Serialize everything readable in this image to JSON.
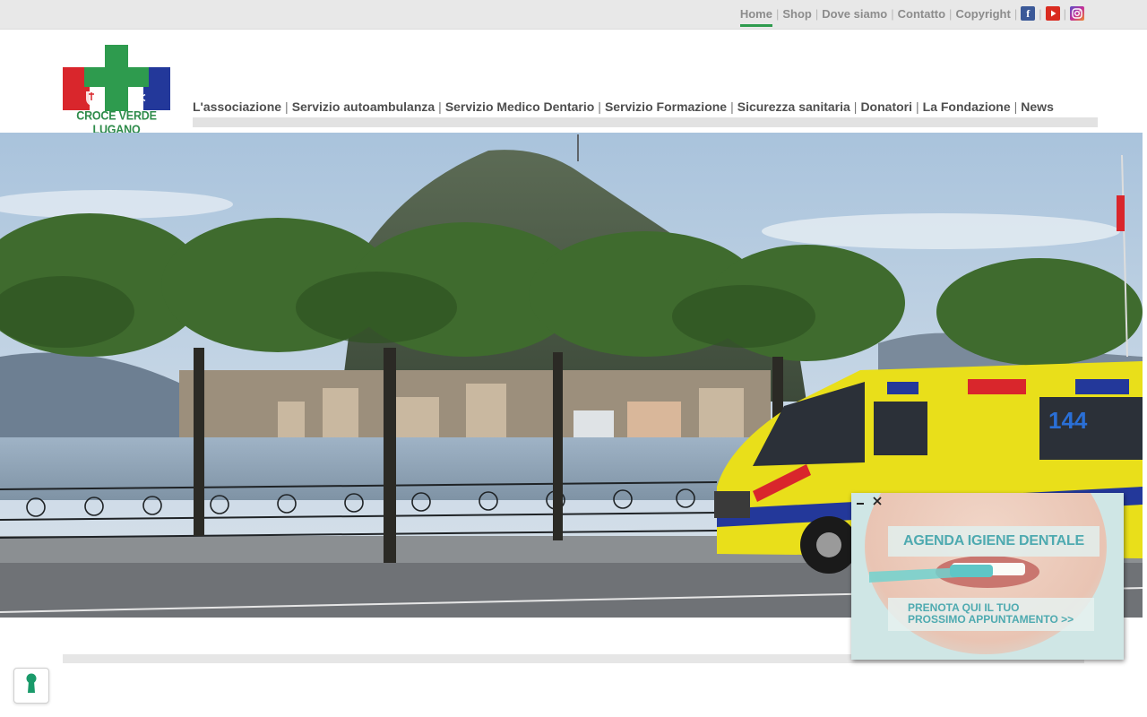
{
  "top_nav": {
    "items": [
      {
        "label": "Home",
        "active": true
      },
      {
        "label": "Shop",
        "active": false
      },
      {
        "label": "Dove siamo",
        "active": false
      },
      {
        "label": "Contatto",
        "active": false
      },
      {
        "label": "Copyright",
        "active": false
      }
    ],
    "separator": "|",
    "social": [
      {
        "name": "facebook-icon",
        "glyph": "f",
        "color": "#3b5998"
      },
      {
        "name": "youtube-icon",
        "color": "#d92b20"
      },
      {
        "name": "instagram-icon",
        "color": "#c32f9a"
      }
    ]
  },
  "logo": {
    "name": "CROCE VERDE LUGANO",
    "colors": {
      "green": "#2e9b4e",
      "red": "#d9262c",
      "blue": "#23389a"
    }
  },
  "main_nav": {
    "items": [
      "L'associazione",
      "Servizio autoambulanza",
      "Servizio Medico Dentario",
      "Servizio Formazione",
      "Sicurezza sanitaria",
      "Donatori",
      "La Fondazione",
      "News"
    ],
    "separator": "|"
  },
  "hero": {
    "ambulance_number": "144"
  },
  "popup": {
    "title": "AGENDA IGIENE DENTALE",
    "cta_line1": "PRENOTA QUI IL TUO",
    "cta_line2": "PROSSIMO APPUNTAMENTO >>"
  },
  "colors": {
    "accent_green": "#2e9b4e",
    "popup_text": "#4eaab0",
    "nav_text": "#4f4f4f",
    "topbar_bg": "#e8e8e8"
  }
}
